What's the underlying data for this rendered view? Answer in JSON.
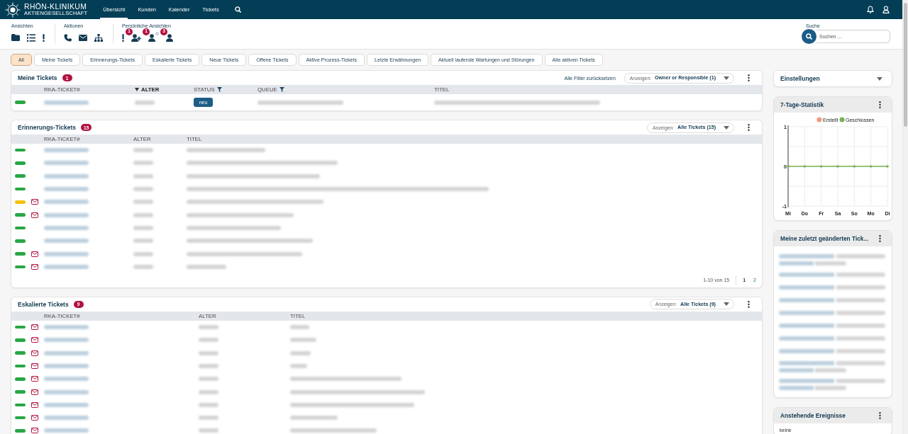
{
  "header": {
    "logo": {
      "name": "RHÖN-KLINIKUM",
      "subtitle": "AKTIENGESELLSCHAFT"
    },
    "nav": [
      {
        "label": "Übersicht",
        "selected": true
      },
      {
        "label": "Kunden",
        "selected": false
      },
      {
        "label": "Kalender",
        "selected": false
      },
      {
        "label": "Tickets",
        "selected": false
      }
    ]
  },
  "toolbar": {
    "groups": [
      {
        "label": "Ansichten",
        "buttons": [
          {
            "kind": "folder"
          },
          {
            "kind": "list"
          },
          {
            "kind": "alert"
          }
        ]
      },
      {
        "label": "Aktionen",
        "buttons": [
          {
            "kind": "phone"
          },
          {
            "kind": "mail"
          },
          {
            "kind": "sitemap"
          }
        ]
      },
      {
        "label": "Persönliche Ansichten",
        "buttons": [
          {
            "kind": "alert"
          },
          {
            "kind": "user-add",
            "badge": "1"
          },
          {
            "kind": "user-gear",
            "badge": "1"
          },
          {
            "kind": "user",
            "badge": "3"
          }
        ]
      }
    ],
    "search": {
      "label": "Suche",
      "placeholder": "Suchen ..."
    }
  },
  "filters": [
    {
      "label": "All",
      "selected": true
    },
    {
      "label": "Meine Tickets",
      "selected": false
    },
    {
      "label": "Erinnerungs-Tickets",
      "selected": false
    },
    {
      "label": "Eskalierte Tickets",
      "selected": false
    },
    {
      "label": "Neue Tickets",
      "selected": false
    },
    {
      "label": "Offene Tickets",
      "selected": false
    },
    {
      "label": "Aktive Prozess-Tickets",
      "selected": false
    },
    {
      "label": "Letzte Erwähnungen",
      "selected": false
    },
    {
      "label": "Aktuell laufende Wartungen und Störungen",
      "selected": false
    },
    {
      "label": "Alle aktiven Tickets",
      "selected": false
    }
  ],
  "widgets": [
    {
      "title": "Meine Tickets",
      "count": "1",
      "reset_link": "Alle Filter zurücksetzen",
      "view": {
        "label": "Anzeigen:",
        "value": "Owner or Responsible (1)"
      },
      "columns": [
        {
          "label": "RKA-TICKET#",
          "kind": "text",
          "sorted": false,
          "filter": false
        },
        {
          "label": "ALTER",
          "kind": "text",
          "sorted": true,
          "filter": false
        },
        {
          "label": "STATUS",
          "kind": "status",
          "sorted": false,
          "filter": true
        },
        {
          "label": "QUEUE",
          "kind": "text",
          "sorted": false,
          "filter": true
        },
        {
          "label": "TITEL",
          "kind": "text",
          "sorted": false,
          "filter": false
        }
      ],
      "rows": [
        {
          "color": "#28a745",
          "mail": false,
          "status": "neu"
        }
      ]
    },
    {
      "title": "Erinnerungs-Tickets",
      "count": "15",
      "view": {
        "label": "Anzeigen:",
        "value": "Alle Tickets (15)"
      },
      "columns": [
        {
          "label": "RKA-TICKET#",
          "kind": "text",
          "sorted": false,
          "filter": false
        },
        {
          "label": "ALTER",
          "kind": "text",
          "sorted": false,
          "filter": false
        },
        {
          "label": "TITEL",
          "kind": "text",
          "sorted": false,
          "filter": false
        }
      ],
      "rows": [
        {
          "color": "#28a745",
          "mail": false
        },
        {
          "color": "#28a745",
          "mail": false
        },
        {
          "color": "#28a745",
          "mail": false
        },
        {
          "color": "#28a745",
          "mail": false
        },
        {
          "color": "#f4c20d",
          "mail": true
        },
        {
          "color": "#28a745",
          "mail": true
        },
        {
          "color": "#28a745",
          "mail": false
        },
        {
          "color": "#28a745",
          "mail": false
        },
        {
          "color": "#28a745",
          "mail": true
        },
        {
          "color": "#28a745",
          "mail": true
        }
      ],
      "pagination": {
        "summary": "1-10 von 15",
        "pages": [
          {
            "label": "1",
            "selected": true
          },
          {
            "label": "2",
            "selected": false
          }
        ]
      }
    },
    {
      "title": "Eskalierte Tickets",
      "count": "9",
      "view": {
        "label": "Anzeigen:",
        "value": "Alle Tickets (9)"
      },
      "columns": [
        {
          "label": "RKA-TICKET#",
          "kind": "text",
          "sorted": false,
          "filter": false
        },
        {
          "label": "ALTER",
          "kind": "text",
          "sorted": false,
          "filter": false
        },
        {
          "label": "TITEL",
          "kind": "text",
          "sorted": false,
          "filter": false
        }
      ],
      "rows": [
        {
          "color": "#28a745",
          "mail": true
        },
        {
          "color": "#28a745",
          "mail": true
        },
        {
          "color": "#28a745",
          "mail": true
        },
        {
          "color": "#28a745",
          "mail": true
        },
        {
          "color": "#28a745",
          "mail": true
        },
        {
          "color": "#28a745",
          "mail": true
        },
        {
          "color": "#28a745",
          "mail": true
        },
        {
          "color": "#28a745",
          "mail": true
        },
        {
          "color": "#28a745",
          "mail": true
        }
      ]
    }
  ],
  "sidebar": {
    "settings": {
      "label": "Einstellungen"
    },
    "stats": {
      "title": "7-Tage-Statistik",
      "chart_data": {
        "type": "line",
        "categories": [
          "Mi",
          "Do",
          "Fr",
          "Sa",
          "So",
          "Mo",
          "Di"
        ],
        "ylim": [
          -1,
          1
        ],
        "yticks": [
          -1,
          0,
          1
        ],
        "grid": true,
        "legend": "top",
        "series": [
          {
            "name": "Erstellt",
            "color": "#f29a7e",
            "values": [
              null,
              null,
              null,
              null,
              null,
              null,
              null
            ]
          },
          {
            "name": "Geschlossen",
            "color": "#77b255",
            "values": [
              0,
              0,
              0,
              0,
              0,
              0,
              0
            ]
          }
        ]
      }
    },
    "recent": {
      "title": "Meine zuletzt geänderten Tick...",
      "items": [
        {
          "kind": "wrapped"
        },
        {
          "kind": "single"
        },
        {
          "kind": "single"
        },
        {
          "kind": "single"
        },
        {
          "kind": "single"
        },
        {
          "kind": "single"
        },
        {
          "kind": "single"
        },
        {
          "kind": "single"
        },
        {
          "kind": "wrapped"
        },
        {
          "kind": "wrapped"
        }
      ]
    },
    "events": {
      "title": "Anstehende Ereignisse",
      "empty": "keine"
    }
  }
}
